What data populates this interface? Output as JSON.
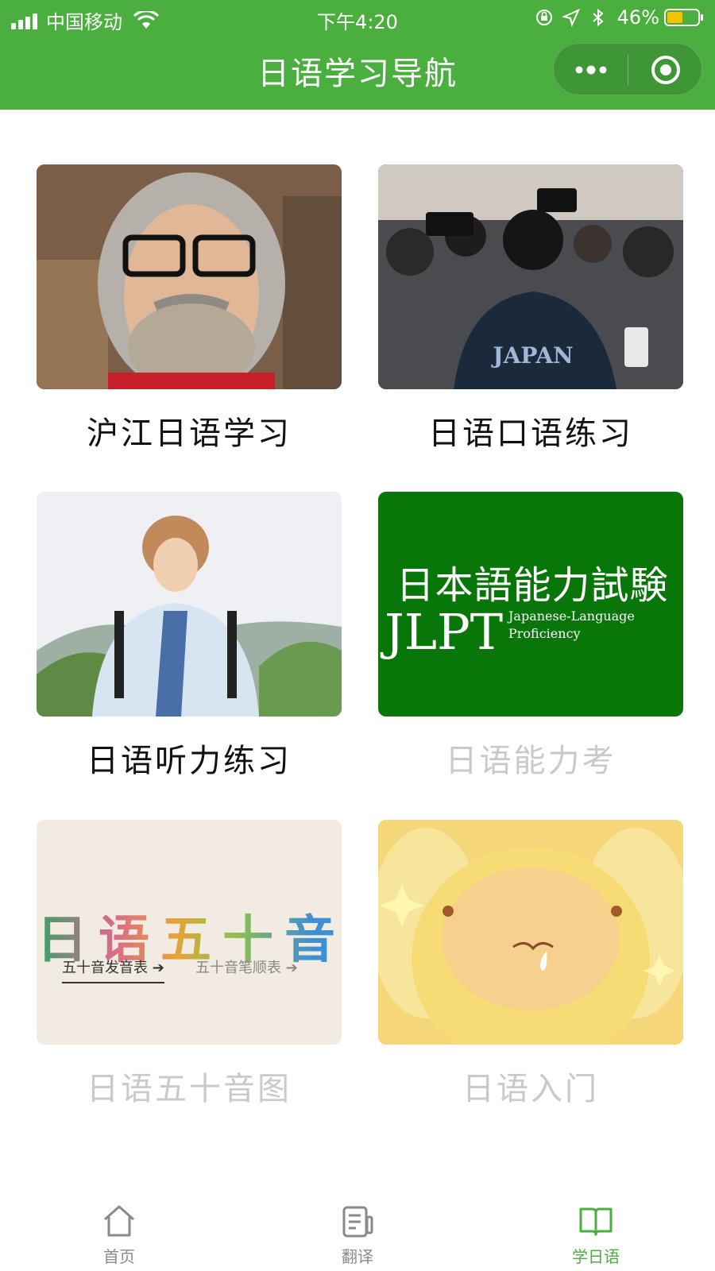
{
  "status_bar": {
    "carrier": "中国移动",
    "time": "下午4:20",
    "battery": "46%"
  },
  "nav": {
    "title": "日语学习导航",
    "more_icon": "more-dots-icon",
    "close_icon": "target-circle-icon"
  },
  "cards": [
    {
      "label": "沪江日语学习",
      "image": "man-with-gray-wig-and-beard"
    },
    {
      "label": "日语口语练习",
      "image": "press-crowd-japan-jacket"
    },
    {
      "label": "日语听力练习",
      "image": "young-man-with-backpack-outdoors"
    },
    {
      "label": "日语能力考",
      "image": "jlpt-banner"
    },
    {
      "label": "日语五十音图",
      "image": "gojuon-banner"
    },
    {
      "label": "日语入门",
      "image": "yellow-cartoon-creature"
    }
  ],
  "jlpt_banner": {
    "title_jp": "日本語能力試験",
    "title_en": "JLPT",
    "subtitle": "Japanese-Language\nProficiency"
  },
  "gojuon_banner": {
    "title": "日语五十音",
    "link1": "五十音发音表 ➔",
    "link2": "五十音笔顺表 ➔"
  },
  "tabbar": {
    "items": [
      {
        "label": "首页",
        "icon": "home-icon",
        "active": false
      },
      {
        "label": "翻译",
        "icon": "document-edit-icon",
        "active": false
      },
      {
        "label": "学日语",
        "icon": "open-book-icon",
        "active": true
      }
    ]
  },
  "colors": {
    "brand_green": "#4aaf3f",
    "jlpt_green": "#087608",
    "label_dim": "#c9c9c9"
  }
}
